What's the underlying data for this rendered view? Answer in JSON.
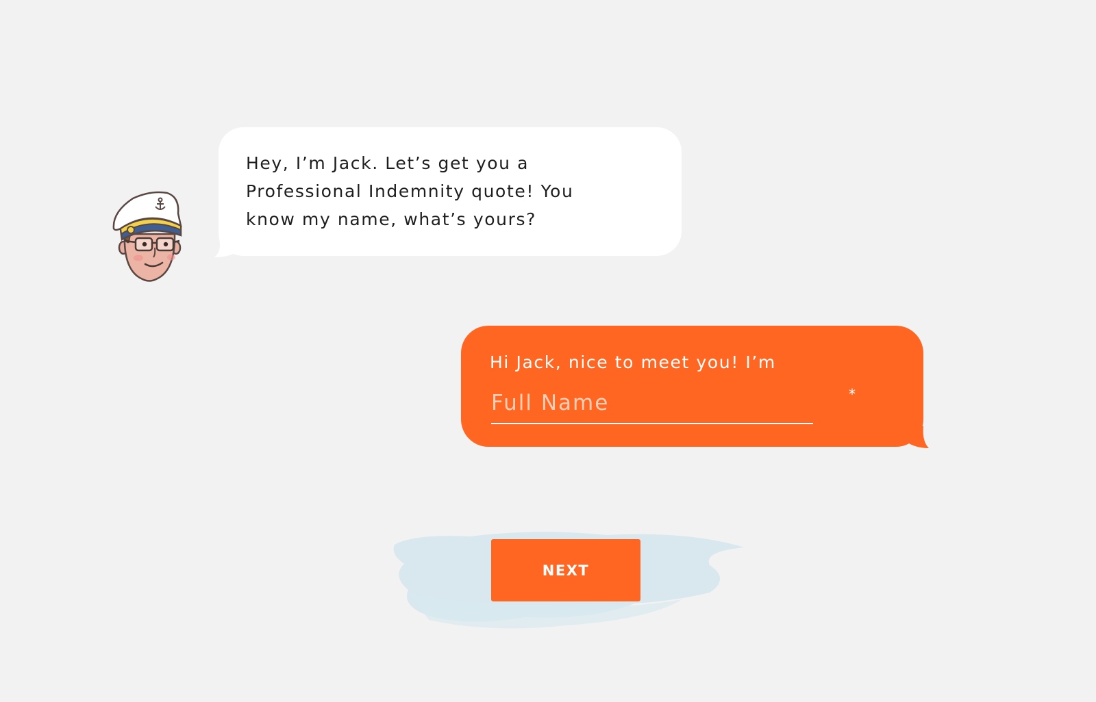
{
  "bot": {
    "message": "Hey, I’m Jack. Let’s get you a Professional Indemnity quote! You know my name, what’s yours?"
  },
  "user": {
    "message_prefix": "Hi Jack, nice to meet you! I’m",
    "name_field": {
      "placeholder": "Full Name",
      "value": "",
      "required_marker": "*"
    }
  },
  "actions": {
    "next_label": "NEXT"
  },
  "colors": {
    "background": "#f2f2f2",
    "accent": "#ff6622",
    "bot_bubble": "#ffffff",
    "brush": "#cfe4ec"
  },
  "icons": {
    "avatar": "captain-jack-avatar-icon",
    "anchor": "anchor-icon"
  }
}
